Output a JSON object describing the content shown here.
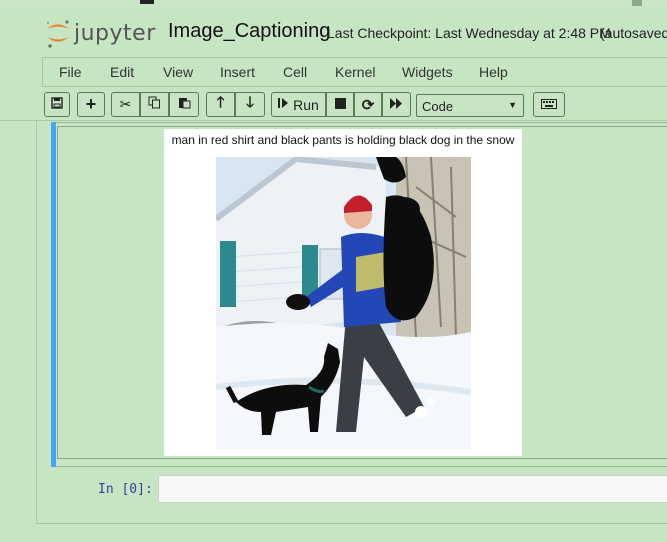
{
  "header": {
    "logo_text": "jupyter",
    "notebook_title": "Image_Captioning",
    "checkpoint": "Last Checkpoint: Last Wednesday at 2:48 PM",
    "autosave_status": "(autosaved)"
  },
  "menubar": {
    "items": [
      "File",
      "Edit",
      "View",
      "Insert",
      "Cell",
      "Kernel",
      "Widgets",
      "Help"
    ]
  },
  "toolbar": {
    "buttons": [
      "save-icon",
      "plus-icon",
      "scissors-icon",
      "copy-icon",
      "paste-icon",
      "arrow-up-icon",
      "arrow-down-icon",
      "run-icon",
      "stop-icon",
      "restart-icon",
      "fast-forward-icon",
      "keyboard-icon"
    ],
    "run_label": "Run",
    "cell_type": "Code"
  },
  "output": {
    "caption": "man in red shirt and black pants is holding black dog in the snow"
  },
  "input_cell": {
    "prompt": "In [0]:",
    "code": ""
  },
  "colors": {
    "background": "#c6e5c3",
    "selected_bar": "#42a5f5",
    "prompt": "#303f9f",
    "logo_orange": "#f37726"
  }
}
